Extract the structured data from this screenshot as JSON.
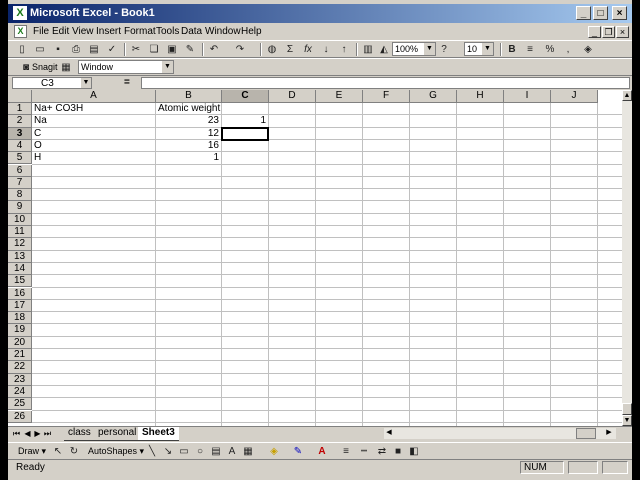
{
  "window": {
    "title": "Microsoft Excel - Book1"
  },
  "menu": [
    "File",
    "Edit",
    "View",
    "Insert",
    "Format",
    "Tools",
    "Data",
    "Window",
    "Help"
  ],
  "toolbar": {
    "zoom": "100%",
    "font_size": "10"
  },
  "snagit": {
    "label": "Snagit",
    "combo_value": "Window"
  },
  "formula": {
    "name_box": "C3",
    "equals": "=",
    "value": ""
  },
  "grid": {
    "columns": [
      "A",
      "B",
      "C",
      "D",
      "E",
      "F",
      "G",
      "H",
      "I",
      "J"
    ],
    "selected_column": "C",
    "selected_row": "3",
    "rows": [
      "1",
      "2",
      "3",
      "4",
      "5",
      "6",
      "7",
      "8",
      "9",
      "10",
      "11",
      "12",
      "13",
      "14",
      "15",
      "16",
      "17",
      "18",
      "19",
      "20",
      "21",
      "22",
      "23",
      "24",
      "25",
      "26"
    ],
    "cells": {
      "A1": "Na+ CO3H",
      "B1": "Atomic weight",
      "A2": "Na",
      "B2": "23",
      "C2": "1",
      "A3": "C",
      "B3": "12",
      "A4": "O",
      "B4": "16",
      "A5": "H",
      "B5": "1"
    }
  },
  "sheets": [
    "class",
    "personal",
    "Sheet3"
  ],
  "active_sheet": "Sheet3",
  "drawing": {
    "draw_label": "Draw",
    "autoshapes_label": "AutoShapes"
  },
  "status": {
    "text": "Ready",
    "num": "NUM"
  },
  "colors": {
    "title_start": "#0a246a",
    "title_end": "#a6caf0",
    "chrome": "#d4d0c8"
  }
}
